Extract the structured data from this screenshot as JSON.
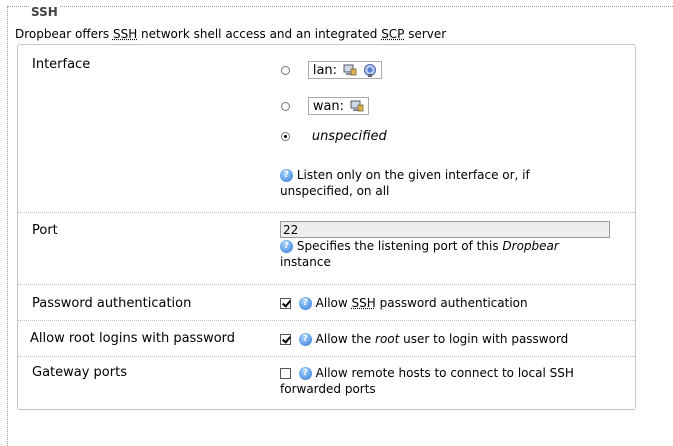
{
  "section": {
    "legend": "SSH",
    "description_pre": "Dropbear offers ",
    "description_abbr1": "SSH",
    "description_mid": " network shell access and an integrated ",
    "description_abbr2": "SCP",
    "description_post": " server"
  },
  "interface": {
    "label": "Interface",
    "options": [
      {
        "name": "lan:",
        "selected": false
      },
      {
        "name": "wan:",
        "selected": false
      },
      {
        "name": "unspecified",
        "selected": true
      }
    ],
    "help_line1": "Listen only on the given interface or, if",
    "help_line2": "unspecified, on all"
  },
  "port": {
    "label": "Port",
    "value": "22",
    "help_pre": "Specifies the listening port of this ",
    "help_em": "Dropbear",
    "help_post": "instance"
  },
  "password_auth": {
    "label": "Password authentication",
    "checked": true,
    "help_pre": "Allow ",
    "help_abbr": "SSH",
    "help_post": " password authentication"
  },
  "root_login": {
    "label": "Allow root logins with password",
    "checked": true,
    "help_pre": "Allow the ",
    "help_em": "root",
    "help_post": " user to login with password"
  },
  "gateway_ports": {
    "label": "Gateway ports",
    "checked": false,
    "help_line1": "Allow remote hosts to connect to local SSH",
    "help_line2": "forwarded ports"
  },
  "icons": {
    "help": "help-icon",
    "network": "network-interface-icon",
    "wifi": "wireless-icon"
  }
}
